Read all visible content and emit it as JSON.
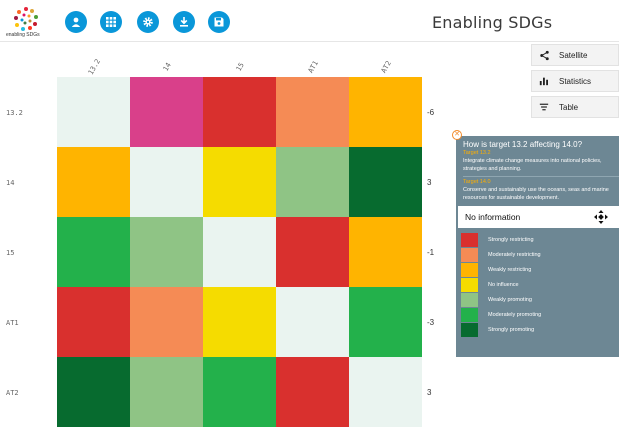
{
  "logo_text": "enabling SDGs",
  "app_title": "Enabling SDGs",
  "toolbar": [
    {
      "name": "user-icon-button",
      "icon": "user-icon"
    },
    {
      "name": "grid-icon-button",
      "icon": "grid-icon"
    },
    {
      "name": "settings-icon-button",
      "icon": "gear-icon"
    },
    {
      "name": "download-icon-button",
      "icon": "download-icon"
    },
    {
      "name": "save-icon-button",
      "icon": "save-icon"
    }
  ],
  "toolbar_color": "#0a97d9",
  "right_buttons": [
    {
      "label": "Satellite",
      "icon": "share-icon"
    },
    {
      "label": "Statistics",
      "icon": "bar-chart-icon"
    },
    {
      "label": "Table",
      "icon": "filter-icon"
    }
  ],
  "matrix": {
    "columns": [
      "13.2",
      "14",
      "15",
      "AT1",
      "AT2"
    ],
    "rows": [
      {
        "label": "13.2",
        "score": "-6",
        "cells": [
          "empty",
          "pink",
          "strongly_restricting",
          "moderately_restricting",
          "weakly_restricting"
        ]
      },
      {
        "label": "14",
        "score": "3",
        "cells": [
          "weakly_restricting",
          "empty",
          "no_influence",
          "weakly_promoting",
          "strongly_promoting"
        ]
      },
      {
        "label": "15",
        "score": "-1",
        "cells": [
          "moderately_promoting",
          "weakly_promoting",
          "empty",
          "strongly_restricting",
          "weakly_restricting"
        ]
      },
      {
        "label": "AT1",
        "score": "-3",
        "cells": [
          "strongly_restricting",
          "moderately_restricting",
          "no_influence",
          "empty",
          "moderately_promoting"
        ]
      },
      {
        "label": "AT2",
        "score": "3",
        "cells": [
          "strongly_promoting",
          "weakly_promoting",
          "moderately_promoting",
          "strongly_restricting",
          "empty"
        ]
      }
    ]
  },
  "colors": {
    "empty": "#eaf4f0",
    "pink": "#d9408a",
    "strongly_restricting": "#d9302e",
    "moderately_restricting": "#f58b55",
    "weakly_restricting": "#ffb400",
    "no_influence": "#f5dc00",
    "weakly_promoting": "#8fc485",
    "moderately_promoting": "#23b14b",
    "strongly_promoting": "#076b2f"
  },
  "info_panel": {
    "title": "How is target 13.2 affecting 14.0?",
    "target_a_label": "Target 13.2",
    "target_a_desc": "Integrate climate change measures into national policies, strategies and planning.",
    "target_b_label": "Target 14.0",
    "target_b_desc": "Conserve and sustainably use the oceans, seas and marine resources for sustainable development.",
    "selection": "No information",
    "legend": [
      {
        "key": "strongly_restricting",
        "label": "Strongly restricting"
      },
      {
        "key": "moderately_restricting",
        "label": "Moderately restricting"
      },
      {
        "key": "weakly_restricting",
        "label": "Weakly restricting"
      },
      {
        "key": "no_influence",
        "label": "No influence"
      },
      {
        "key": "weakly_promoting",
        "label": "Weakly promoting"
      },
      {
        "key": "moderately_promoting",
        "label": "Moderately promoting"
      },
      {
        "key": "strongly_promoting",
        "label": "Strongly promoting"
      }
    ]
  }
}
